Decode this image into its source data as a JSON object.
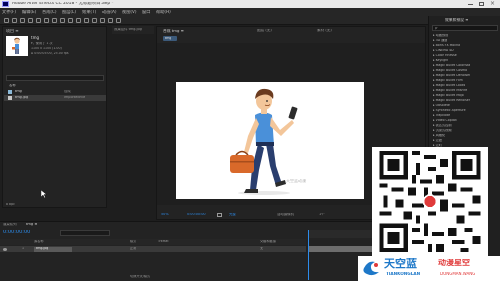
{
  "window": {
    "title": "Adobe After Effects CC 2018 - 无标题项目.aep *"
  },
  "menu": [
    "文件(F)",
    "编辑(E)",
    "合成(C)",
    "图层(L)",
    "效果(T)",
    "动画(A)",
    "视图(V)",
    "窗口",
    "帮助(H)"
  ],
  "project_panel": {
    "title": "项目 ≡",
    "tab": "效果控件 tmg.jpg",
    "selected_item": "tmg",
    "selected_info_line1": "▾，使用了 1 次",
    "selected_info_line2": "1100 x 1100 (1.00)",
    "selected_info_line3": "Δ 0:00:05:00, 25.00 fps",
    "column_name": "名称",
    "items": [
      {
        "name": "tmg",
        "type": "合成"
      },
      {
        "name": "tmg.jpg",
        "type": "ImportedFile"
      }
    ],
    "footer": "8 bpc"
  },
  "composition": {
    "tab": "合成 tmg ≡",
    "breadcrumb": "tmg",
    "layer_panel": "图层 (无)",
    "footage_panel": "素材 (无)",
    "zoom": "50%",
    "timecode": "0:00:00:00",
    "resolution": "完整",
    "camera": "活动摄像机",
    "view_count": "1个",
    "exposure": "+0.0",
    "watermark": "天空蓝动漫"
  },
  "effects_panel": {
    "title": "效果和预设 ≡",
    "search_placeholder": "ρ·",
    "items": [
      "▸ 动画预设",
      "▸ 3D 通道",
      "▸ Boris FX Mocha",
      "▸ CINEMA 4D",
      "▸ Color Finesse",
      "▸ Keylight",
      "▸ Magic Bullet Colorista",
      "▸ Magic Bullet Cosmo",
      "▸ Magic Bullet Denoiser",
      "▸ Magic Bullet Film",
      "▸ Magic Bullet Looks",
      "▸ Magic Bullet MisFire",
      "▸ Magic Bullet Mojo",
      "▸ Magic Bullet Renoiser",
      "▸ Obsolete",
      "▸ Synthetic Aperture",
      "▸ Trapcode",
      "▸ Video Copilot",
      "▸ 表达式控制",
      "▸ 沉浸式视频",
      "▸ 风格化",
      "▸ 过渡",
      "▸ 过时",
      "▸ 抠像",
      "▸ 模糊和锐化",
      "▸ 模拟",
      "▸ 扭曲",
      "▸ 生成",
      "▸ 时间",
      "▸ 实用工具",
      "▸ 通道",
      "▸ 透视",
      "▸ 文本"
    ]
  },
  "timeline": {
    "tab": "tmg ≡",
    "render_queue_tab": "渲染队列",
    "timecode": "0:00:00:00",
    "columns": {
      "source": "源名称",
      "mode": "模式",
      "trkmat": "TrkMat",
      "parent": "父级和链接"
    },
    "layer": {
      "index": "1",
      "name": "tmg.jpg",
      "mode": "正常",
      "parent": "无"
    },
    "footer": "切换开关/模式"
  },
  "brand": {
    "name": "天空蓝",
    "sub": "TIANKONGLAN",
    "tagline": "动漫星空",
    "url": "DONGMAN.WANG"
  },
  "colors": {
    "accent": "#2d8ceb",
    "brand_blue": "#1e78c8",
    "brand_red": "#e03a3a",
    "selection": "#3a3a3a"
  }
}
